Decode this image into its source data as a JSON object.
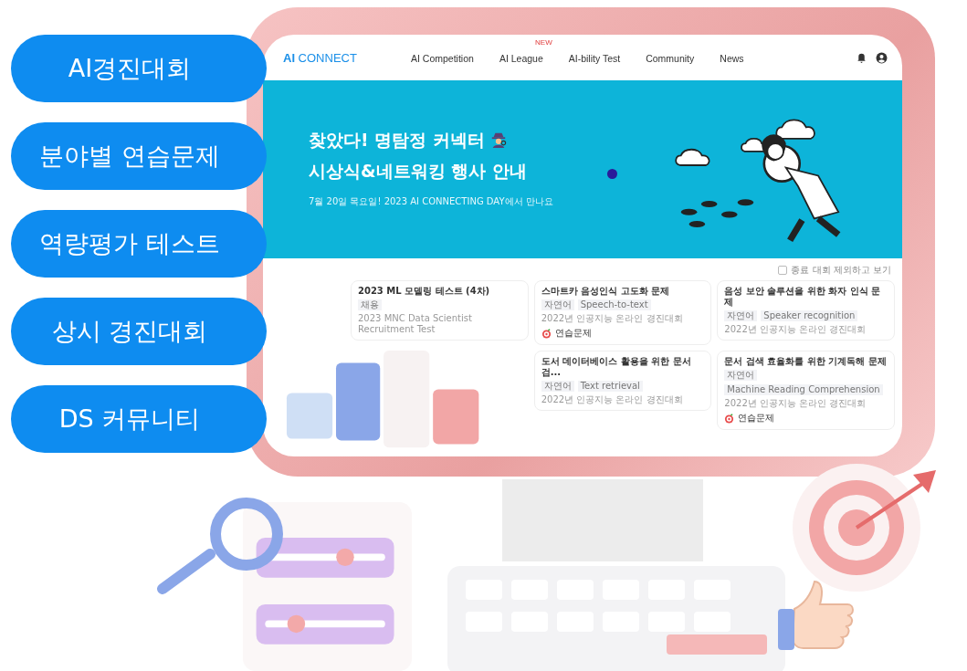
{
  "side_menu": [
    {
      "label": "AI경진대회"
    },
    {
      "label": "분야별 연습문제"
    },
    {
      "label": "역량평가 테스트"
    },
    {
      "label": "상시 경진대회"
    },
    {
      "label": "DS 커뮤니티"
    }
  ],
  "site": {
    "logo": {
      "accent": "AI",
      "name": "CONNECT"
    },
    "nav": [
      {
        "label": "AI Competition"
      },
      {
        "label": "AI League",
        "badge": "NEW"
      },
      {
        "label": "AI-bility Test"
      },
      {
        "label": "Community"
      },
      {
        "label": "News"
      }
    ],
    "banner": {
      "title_lines": [
        "찾았다! 명탐정 커넥터",
        "시상식&네트워킹 행사 안내"
      ],
      "subtitle": "7월 20일 목요일! 2023 AI CONNECTING DAY에서 만나요"
    },
    "filter": {
      "label": "종료 대회 제외하고 보기",
      "checked": false
    },
    "cards": [
      {
        "title": "2023 ML 모델링 테스트 (4차)",
        "tags": [
          "채용"
        ],
        "source": "2023 MNC Data Scientist Recruitment Test"
      },
      {
        "title": "스마트카 음성인식 고도화 문제",
        "tags": [
          "자연어",
          "Speech-to-text"
        ],
        "source": "2022년 인공지능 온라인 경진대회",
        "badge": "연습문제"
      },
      {
        "title": "음성 보안 솔루션을 위한 화자 인식 문제",
        "tags": [
          "자연어",
          "Speaker recognition"
        ],
        "source": "2022년 인공지능 온라인 경진대회"
      },
      {
        "title": "도서 데이터베이스 활용을 위한 문서 검...",
        "tags": [
          "자연어",
          "Text retrieval"
        ],
        "source": "2022년 인공지능 온라인 경진대회"
      },
      {
        "title": "문서 검색 효율화를 위한 기계독해 문제",
        "tags": [
          "자연어",
          "Machine Reading Comprehension"
        ],
        "source": "2022년 인공지능 온라인 경진대회",
        "badge": "연습문제"
      }
    ]
  }
}
